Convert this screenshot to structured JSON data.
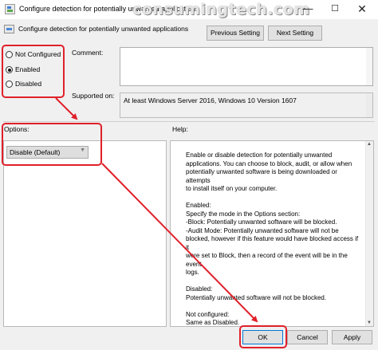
{
  "window": {
    "title": "Configure detection for potentially unwanted applications",
    "watermark": "consumingtech.com",
    "min_glyph": "—",
    "max_glyph": "☐",
    "close_glyph": "✕"
  },
  "header": {
    "title": "Configure detection for potentially unwanted applications",
    "prev_button": "Previous Setting",
    "next_button": "Next Setting"
  },
  "state": {
    "options": [
      {
        "label": "Not Configured",
        "checked": false
      },
      {
        "label": "Enabled",
        "checked": true
      },
      {
        "label": "Disabled",
        "checked": false
      }
    ]
  },
  "comment": {
    "label": "Comment:",
    "value": ""
  },
  "supported": {
    "label": "Supported on:",
    "value": "At least Windows Server 2016, Windows 10 Version 1607"
  },
  "options_section": {
    "label": "Options:",
    "dropdown_value": "Disable (Default)"
  },
  "help_section": {
    "label": "Help:",
    "paragraphs": [
      [
        "Enable or disable detection for potentially unwanted",
        "applications. You can choose to block, audit, or allow when",
        "potentially unwanted software is being downloaded or attempts",
        "to install itself on your computer."
      ],
      [
        "Enabled:",
        "Specify the mode in the Options section:",
        "-Block: Potentially unwanted software will be blocked.",
        "-Audit Mode: Potentially unwanted software will not be",
        "blocked, however if this feature would have blocked access if it",
        "were set to Block, then a record of the event will be in the event",
        "logs."
      ],
      [
        "Disabled:",
        "Potentially unwanted software will not be blocked."
      ],
      [
        "Not configured:",
        "Same as Disabled."
      ]
    ]
  },
  "footer": {
    "ok": "OK",
    "cancel": "Cancel",
    "apply": "Apply"
  },
  "colors": {
    "annotation": "#e0202a",
    "accent": "#0078d7"
  },
  "icons": [
    "group-policy-icon",
    "chevron-down-icon",
    "scroll-up-icon",
    "scroll-down-icon"
  ]
}
